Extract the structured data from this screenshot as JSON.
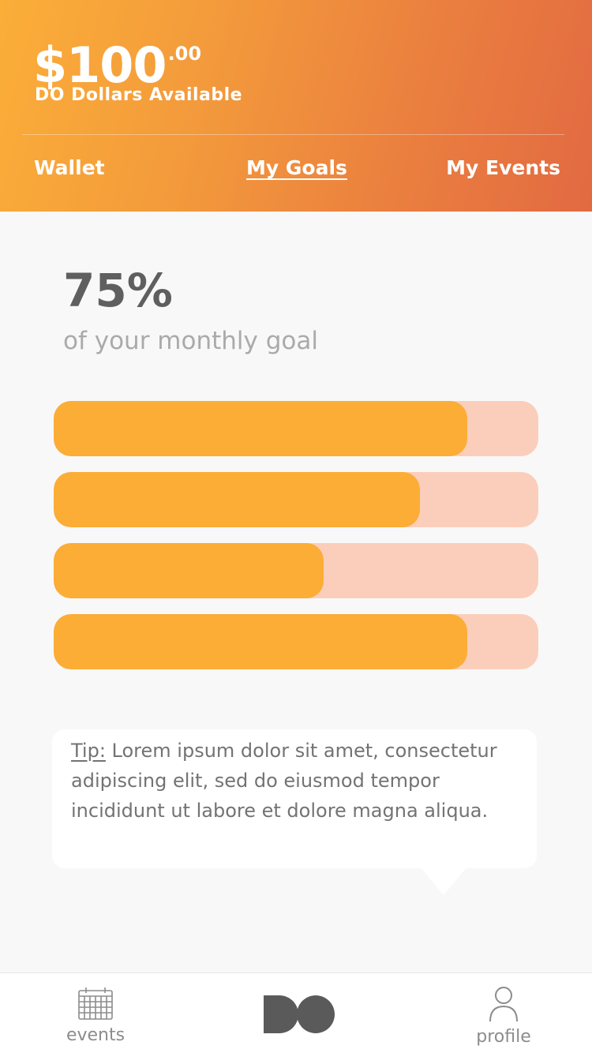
{
  "header": {
    "balance_main": "$100",
    "balance_cents": ".00",
    "balance_label": "DO Dollars Available",
    "tabs": [
      {
        "label": "Wallet",
        "active": false
      },
      {
        "label": "My Goals",
        "active": true
      },
      {
        "label": "My Events",
        "active": false
      }
    ]
  },
  "goal": {
    "percent": "75%",
    "subtitle": "of your monthly goal"
  },
  "progress_bars": [
    {
      "fill_fraction": 0.854
    },
    {
      "fill_fraction": 0.756
    },
    {
      "fill_fraction": 0.557
    },
    {
      "fill_fraction": 0.854
    }
  ],
  "tip": {
    "label": "Tip:",
    "text": " Lorem ipsum dolor sit amet, consectetur adipiscing elit, sed do eiusmod tempor incididunt ut labore et dolore magna aliqua."
  },
  "bottom_nav": {
    "events_label": "events",
    "profile_label": "profile",
    "logo_icon": "do-logo-icon"
  },
  "colors": {
    "header_gradient_start": "#fbae38",
    "header_gradient_end": "#e26a42",
    "bar_fill": "#fbad36",
    "bar_track": "#fbcebb"
  }
}
